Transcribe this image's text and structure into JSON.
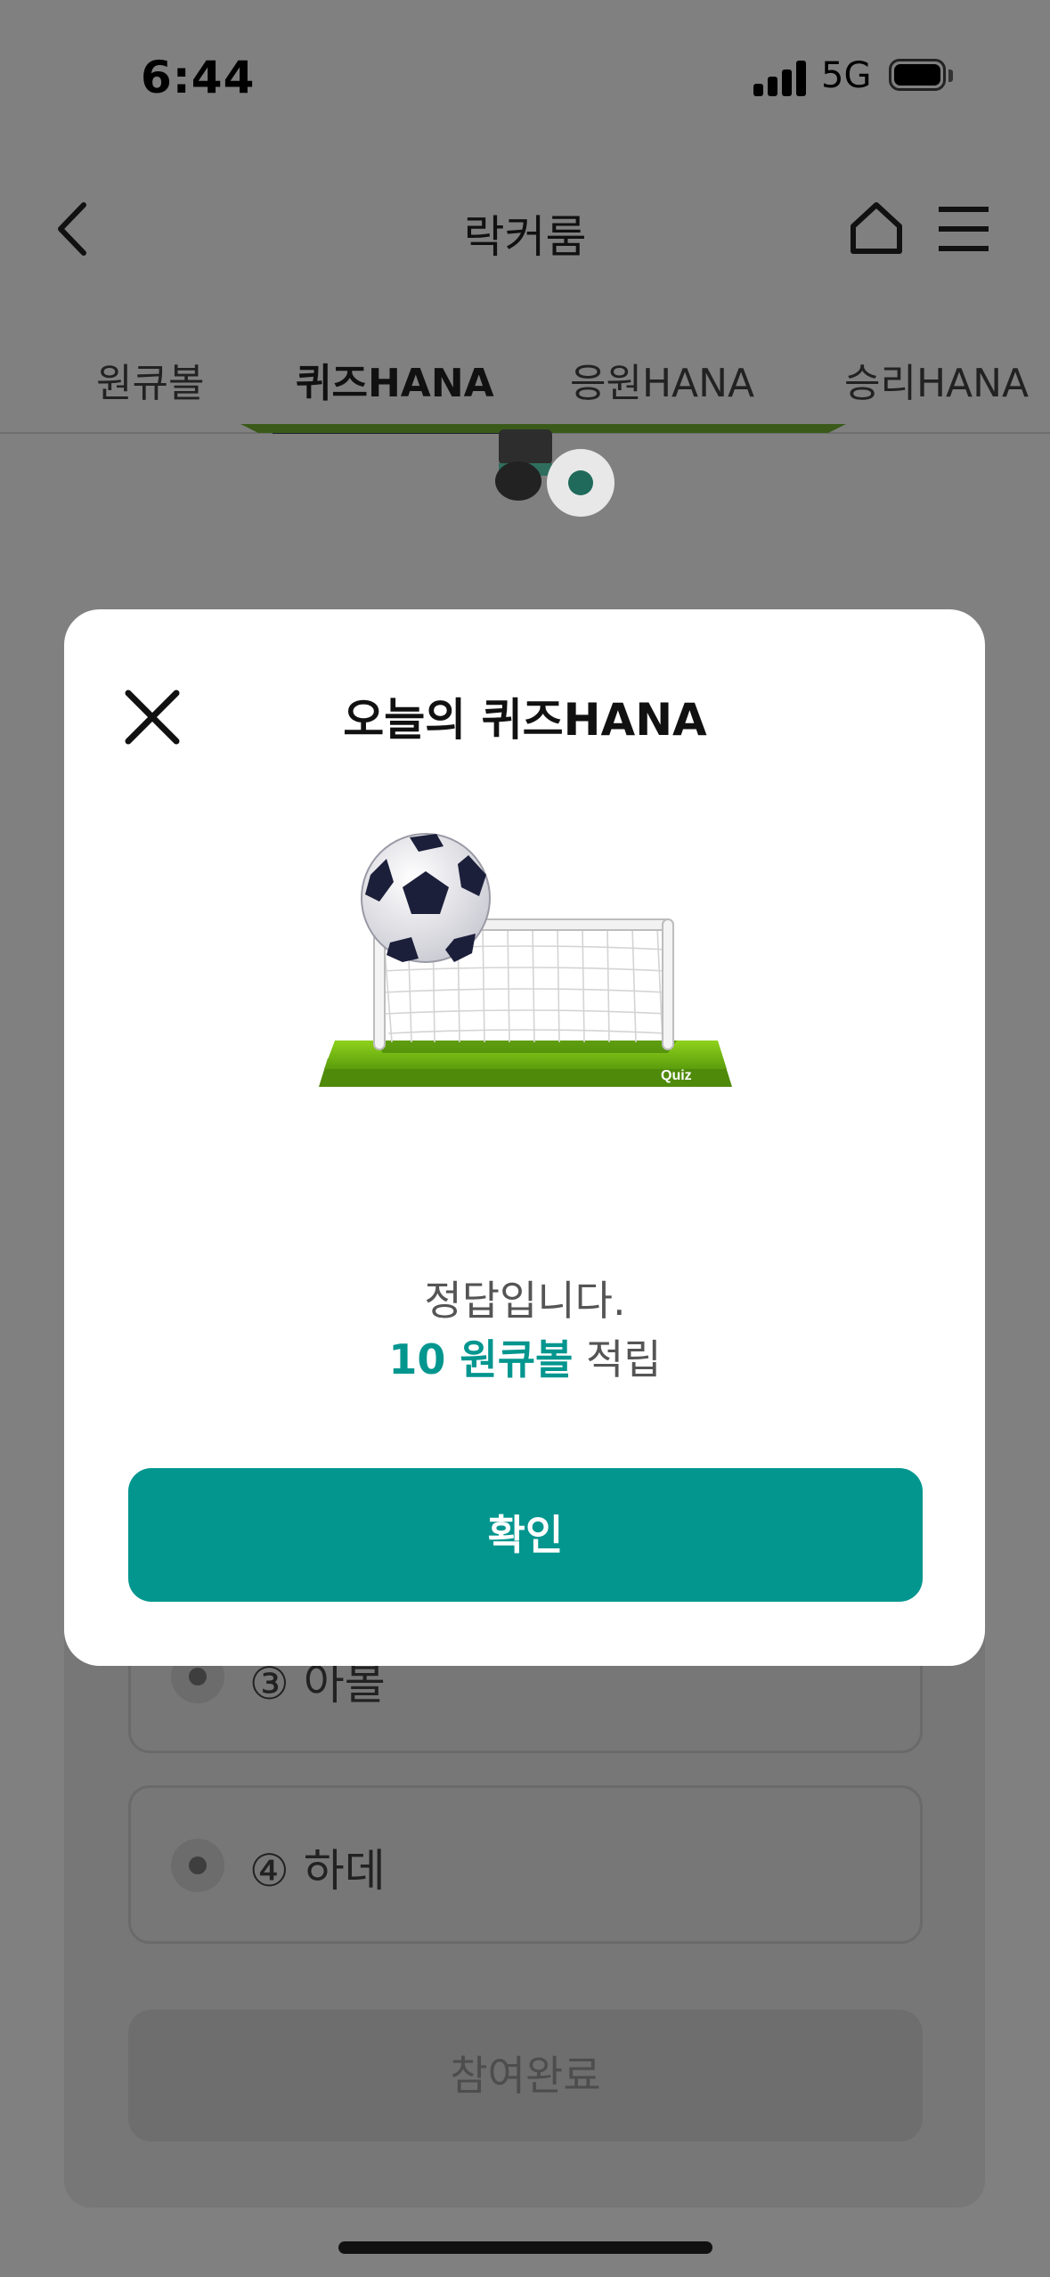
{
  "status_bar": {
    "time": "6:44",
    "network": "5G"
  },
  "header": {
    "title": "락커룸"
  },
  "tabs": [
    {
      "label": "원큐볼",
      "active": false
    },
    {
      "label": "퀴즈HANA",
      "active": true
    },
    {
      "label": "응원HANA",
      "active": false
    },
    {
      "label": "승리HANA",
      "active": false
    }
  ],
  "background": {
    "options": [
      {
        "label": "③ 아볼"
      },
      {
        "label": "④ 하데"
      }
    ],
    "submit_label": "참여완료"
  },
  "modal": {
    "title": "오늘의 퀴즈HANA",
    "illustration_caption": "Quiz",
    "result_text": "정답입니다.",
    "reward_amount": "10 원큐볼",
    "reward_suffix": " 적립",
    "confirm_label": "확인"
  },
  "colors": {
    "accent": "#03968f",
    "overlay": "#808080",
    "field_green": "#74b816"
  },
  "icons": [
    "back-icon",
    "home-icon",
    "menu-icon",
    "close-icon",
    "signal-icon",
    "battery-icon",
    "soccer-ball-icon"
  ]
}
